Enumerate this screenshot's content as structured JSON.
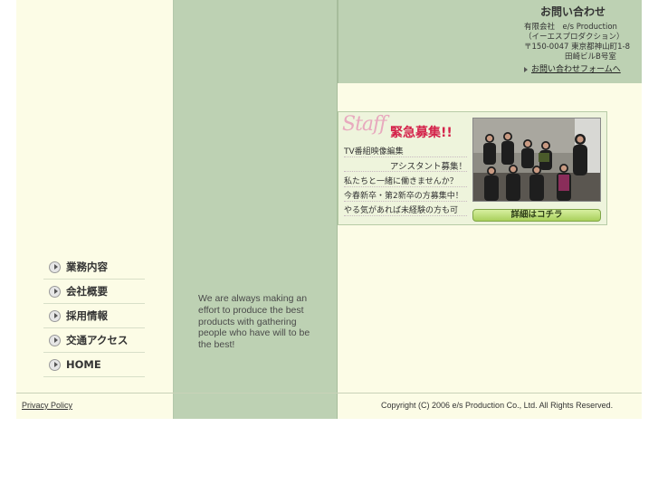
{
  "contact": {
    "title": "お問い合わせ",
    "company": "有限会社　e/s Production",
    "company_kana": "（イーエスプロダクション）",
    "address1": "〒150-0047 東京都神山町1-8",
    "address2": "田崎ビルB号室",
    "form_link": "お問い合わせフォームへ"
  },
  "nav": {
    "items": [
      {
        "label": "業務内容"
      },
      {
        "label": "会社概要"
      },
      {
        "label": "採用情報"
      },
      {
        "label": "交通アクセス"
      },
      {
        "label": "HOME"
      }
    ]
  },
  "tagline": "We are always making an effort to produce the best products with gathering people who have will to be the best!",
  "staff": {
    "logo": "Staff",
    "urgent": "緊急募集!!",
    "lines": [
      "TV番組映像編集",
      "アシスタント募集！",
      "私たちと一緒に働きませんか？",
      "今春新卒・第2新卒の方募集中！",
      "やる気があれば未経験の方も可"
    ],
    "detail_button": "詳細はコチラ"
  },
  "footer": {
    "privacy": "Privacy Policy",
    "copyright": "Copyright (C) 2006 e/s Production Co., Ltd. All Rights Reserved."
  },
  "colors": {
    "sage": "#bdd1b3",
    "cream": "#fcfce6",
    "urgent_red": "#d4224a",
    "button_green": "#a9d05c"
  }
}
